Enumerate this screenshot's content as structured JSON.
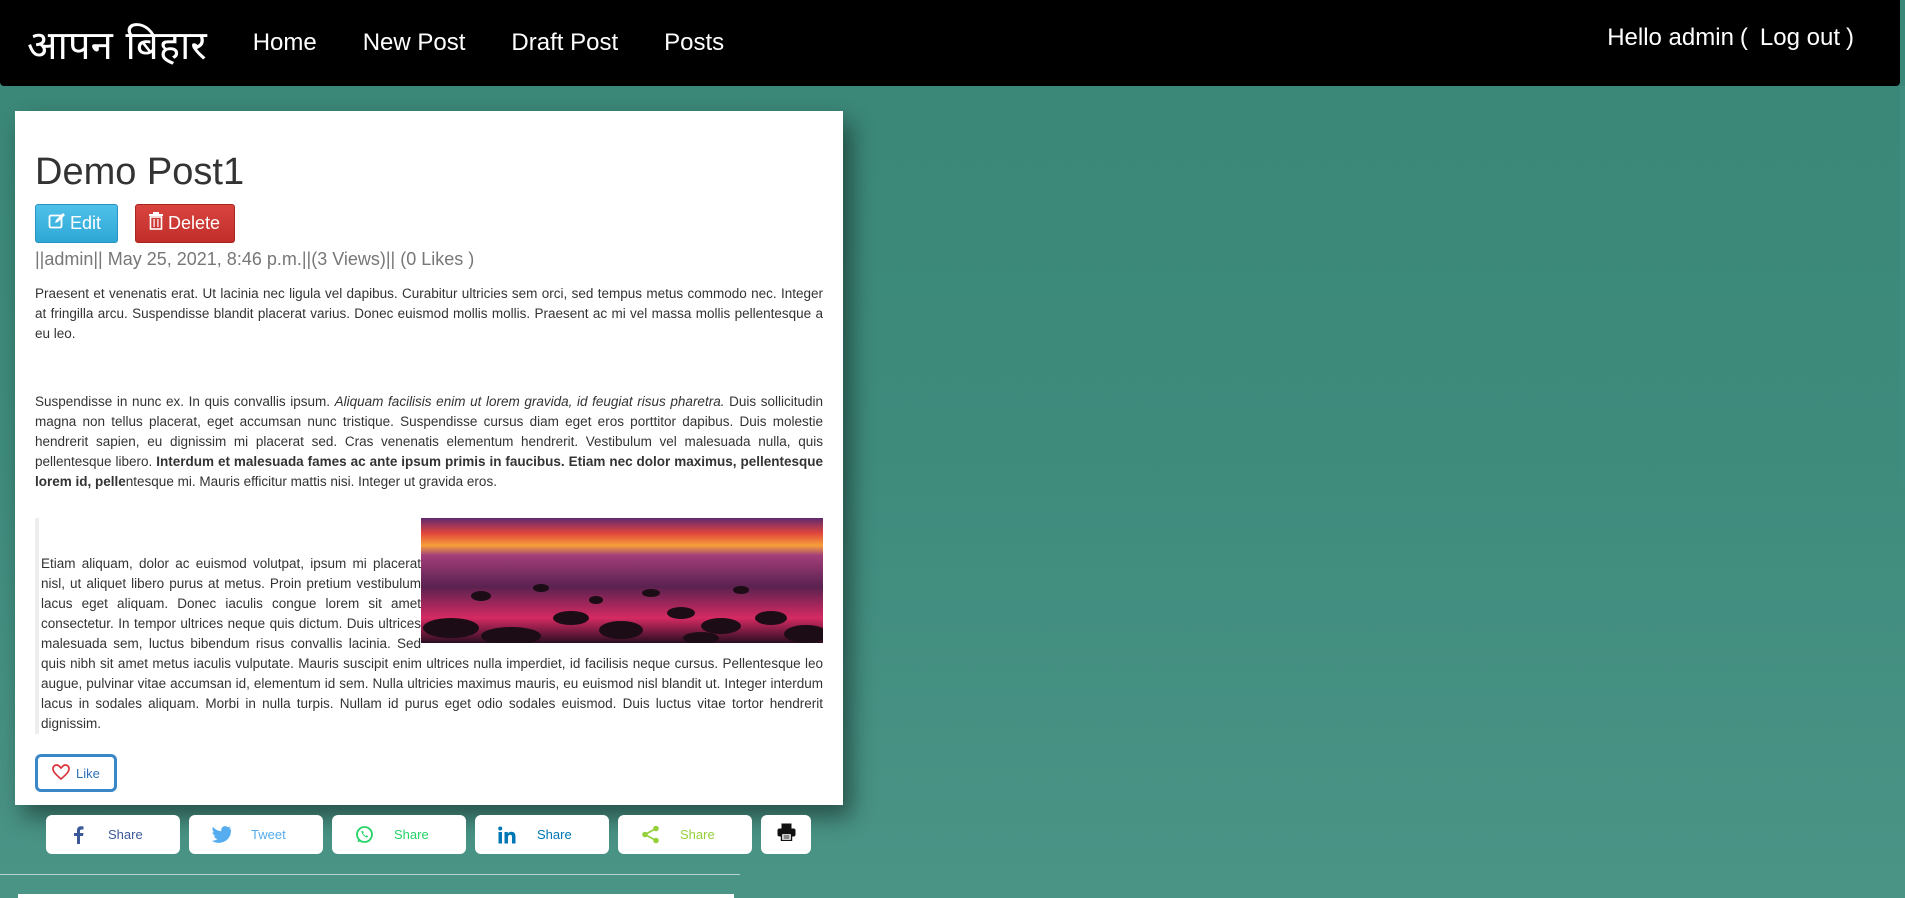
{
  "nav": {
    "brand": "आपन बिहार",
    "links": [
      "Home",
      "New Post",
      "Draft Post",
      "Posts"
    ],
    "greeting": "Hello admin",
    "open_paren": "(",
    "logout": "Log out",
    "close_paren": ")"
  },
  "post": {
    "title": "Demo Post1",
    "edit_label": "Edit",
    "delete_label": "Delete",
    "meta": "||admin|| May 25, 2021, 8:46 p.m.||(3 Views)|| (0 Likes )",
    "p1": "Praesent et venenatis erat. Ut lacinia nec ligula vel dapibus. Curabitur ultricies sem orci, sed tempus metus commodo nec. Integer at fringilla arcu. Suspendisse blandit placerat varius. Donec euismod mollis mollis. Praesent ac mi vel massa mollis pellentesque a eu leo.",
    "p2_a": "Suspendisse in nunc ex. In quis convallis ipsum. ",
    "p2_em": "Aliquam facilisis enim ut lorem gravida, id feugiat risus pharetra.",
    "p2_b": " Duis sollicitudin magna non tellus placerat, eget accumsan nunc tristique. Suspendisse cursus diam eget eros porttitor dapibus. Duis molestie hendrerit sapien, eu dignissim mi placerat sed. Cras venenatis elementum hendrerit. Vestibulum vel malesuada nulla, quis pellentesque libero. ",
    "p2_bold": "Interdum et malesuada fames ac ante ipsum primis in faucibus. Etiam nec dolor maximus, pellentesque lorem id, pelle",
    "p2_c": "ntesque mi. Mauris efficitur mattis nisi. Integer ut gravida eros.",
    "p3": "Etiam aliquam, dolor ac euismod volutpat, ipsum mi placerat nisl, ut aliquet libero purus at metus. Proin pretium vestibulum lacus eget aliquam. Donec iaculis congue lorem sit amet consectetur. In tempor ultrices neque quis dictum. Duis ultrices malesuada sem, luctus bibendum risus convallis lacinia. Sed quis nibh sit amet metus iaculis vulputate. Mauris suscipit enim ultrices nulla imperdiet, id facilisis neque cursus. Pellentesque leo augue, pulvinar vitae accumsan id, elementum id sem. Nulla ultricies maximus mauris, eu euismod nisl blandit ut. Integer interdum lacus in sodales aliquam. Morbi in nulla turpis. Nullam id purus eget odio sodales euismod. Duis luctus vitae tortor hendrerit dignissim.",
    "like_label": "Like"
  },
  "share": {
    "buttons": [
      {
        "label": "Share",
        "icon": "facebook-icon",
        "color": "#3b5998"
      },
      {
        "label": "Tweet",
        "icon": "twitter-icon",
        "color": "#55acee"
      },
      {
        "label": "Share",
        "icon": "whatsapp-icon",
        "color": "#25d366"
      },
      {
        "label": "Share",
        "icon": "linkedin-icon",
        "color": "#0077b5"
      },
      {
        "label": "Share",
        "icon": "share-icon",
        "color": "#95d03a"
      }
    ]
  },
  "colors": {
    "background": "#3e8b7c",
    "navbar": "#000000",
    "edit": "#31b0d5",
    "delete": "#c9302c",
    "like_border": "#3a87c7"
  }
}
